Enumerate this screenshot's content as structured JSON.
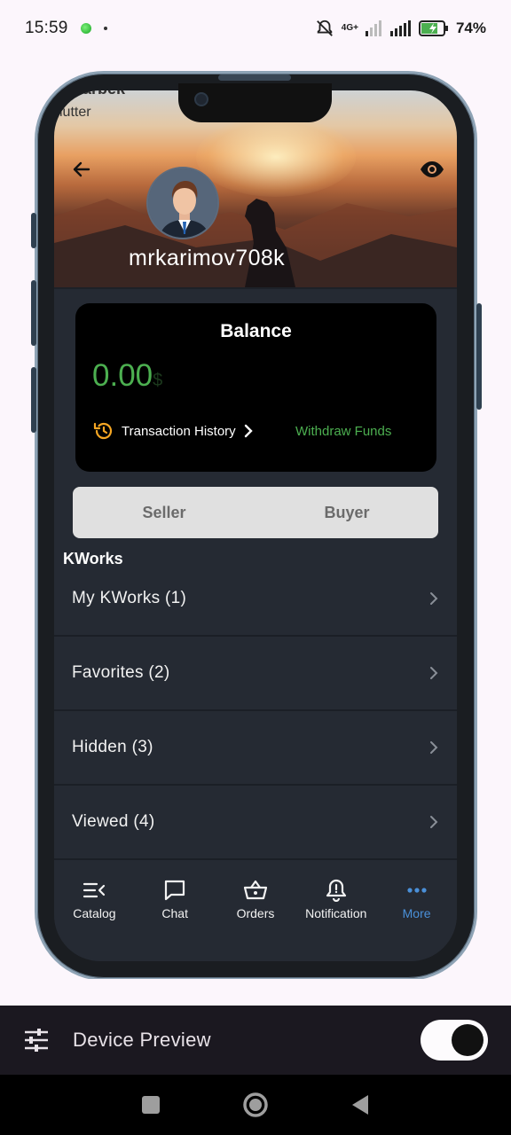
{
  "status_bar": {
    "time": "15:59",
    "network": "4G+",
    "battery": "74%"
  },
  "header": {
    "partial_title": "..arbek",
    "partial_subtitle": "lutter",
    "username": "mrkarimov708k"
  },
  "balance": {
    "title": "Balance",
    "amount": "0.00",
    "currency": "$",
    "transaction_history": "Transaction History",
    "withdraw": "Withdraw Funds"
  },
  "segment": {
    "seller": "Seller",
    "buyer": "Buyer"
  },
  "kworks": {
    "title": "KWorks",
    "items": [
      {
        "label": "My KWorks (1)"
      },
      {
        "label": "Favorites (2)"
      },
      {
        "label": "Hidden (3)"
      },
      {
        "label": "Viewed (4)"
      }
    ]
  },
  "bottom_nav": {
    "catalog": "Catalog",
    "chat": "Chat",
    "orders": "Orders",
    "notification": "Notification",
    "more": "More",
    "active": "More"
  },
  "device_preview": {
    "label": "Device Preview",
    "enabled": true
  },
  "colors": {
    "accent_green": "#4caf50",
    "accent_blue": "#4a90d9",
    "history_icon": "#f5a623",
    "screen_bg": "#252a33"
  },
  "icons": {
    "back": "arrow-left-icon",
    "visibility": "eye-icon",
    "history": "history-icon",
    "chevron": "chevron-right-icon",
    "catalog": "catalog-icon",
    "chat": "chat-icon",
    "orders": "basket-icon",
    "notification": "bell-icon",
    "more": "more-dots-icon",
    "device_settings": "tune-icon"
  }
}
